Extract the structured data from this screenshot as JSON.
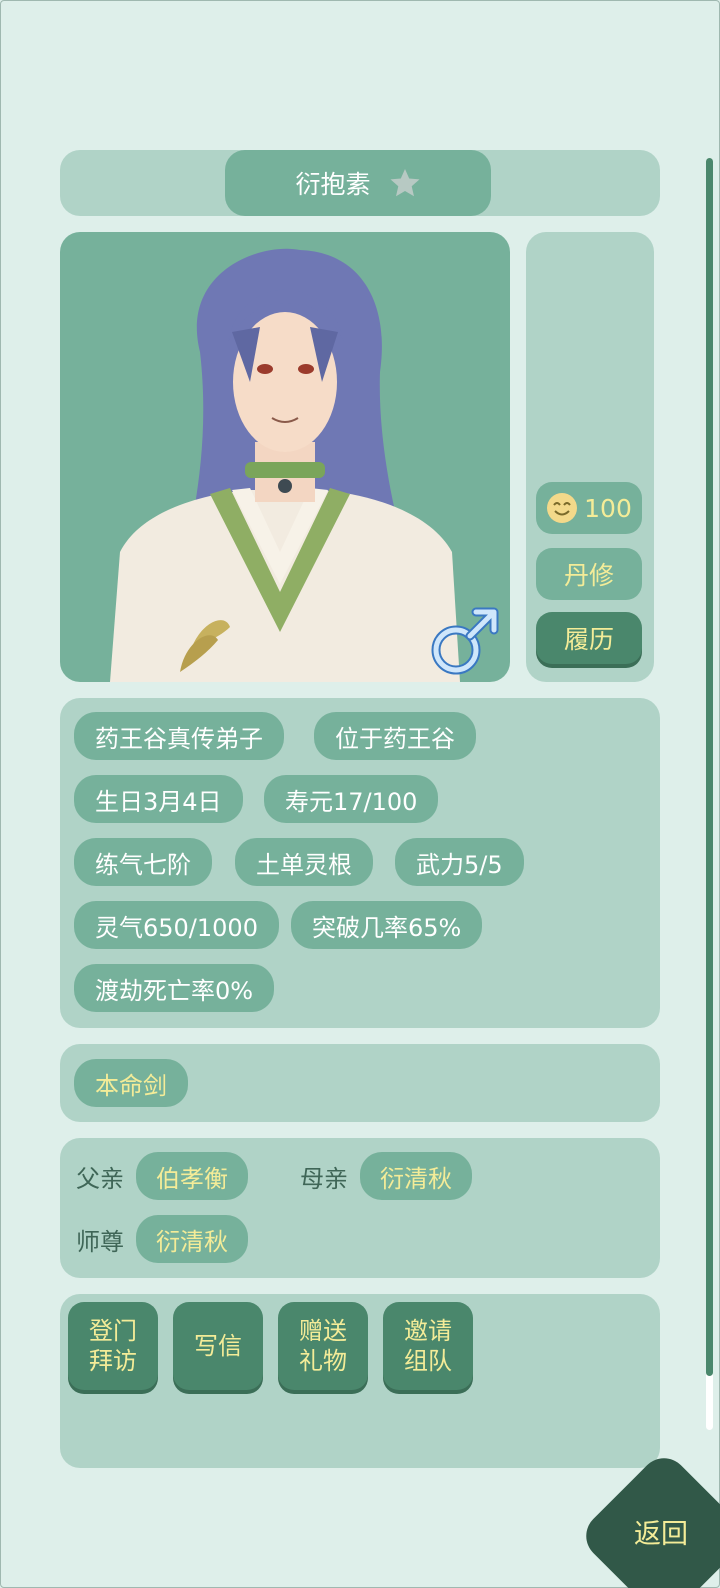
{
  "character": {
    "name": "衍抱素",
    "favorite_icon": "star-icon",
    "gender_icon": "male-symbol-icon",
    "portrait": "long-haired-cultivator-portrait"
  },
  "side": {
    "mood_icon": "smiling-face-icon",
    "mood_value": "100",
    "profession": "丹修",
    "resume_label": "履历"
  },
  "attributes": [
    "药王谷真传弟子",
    "位于药王谷",
    "生日3月4日",
    "寿元17/100",
    "练气七阶",
    "土单灵根",
    "武力5/5",
    "灵气650/1000",
    "突破几率65%",
    "渡劫死亡率0%"
  ],
  "weapon": {
    "label": "本命剑"
  },
  "relations": {
    "father_label": "父亲",
    "father_name": "伯孝衡",
    "mother_label": "母亲",
    "mother_name": "衍清秋",
    "master_label": "师尊",
    "master_name": "衍清秋"
  },
  "actions": [
    {
      "line1": "登门",
      "line2": "拜访"
    },
    {
      "line1": "写信",
      "line2": ""
    },
    {
      "line1": "赠送",
      "line2": "礼物"
    },
    {
      "line1": "邀请",
      "line2": "组队"
    }
  ],
  "back_label": "返回",
  "colors": {
    "background": "#deefea",
    "panel": "#b0d3c7",
    "pill": "#76b19b",
    "button_dark": "#4a876c",
    "back_button": "#315848",
    "accent_text": "#f4ec98"
  }
}
